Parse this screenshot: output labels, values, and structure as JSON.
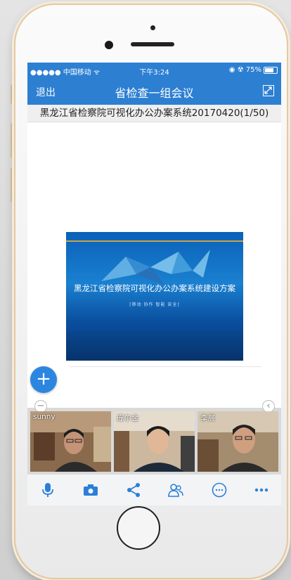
{
  "status_bar": {
    "carrier": "●●●●● 中国移动 ᯤ",
    "time": "下午3:24",
    "right": "◉ ☢ 75%"
  },
  "nav": {
    "back_label": "退出",
    "title": "省检查一组会议",
    "fullscreen_icon": "expand-icon"
  },
  "document": {
    "name": "黑龙江省检察院可视化办公办案系统20170420(1/50)"
  },
  "slide": {
    "title": "黑龙江省检察院可视化办公办案系统建设方案",
    "subtitle": "[移动  协作  智能  安全]"
  },
  "participants": [
    {
      "name": "sunny"
    },
    {
      "name": "庞尔金"
    },
    {
      "name": "李展"
    }
  ],
  "toolbar": {
    "items": [
      "microphone-icon",
      "camera-icon",
      "share-icon",
      "participants-icon",
      "chat-icon",
      "more-icon"
    ]
  },
  "colors": {
    "accent": "#2d7fd2",
    "fab": "#2c86e0",
    "toolbar_icon": "#2a7fd8"
  }
}
